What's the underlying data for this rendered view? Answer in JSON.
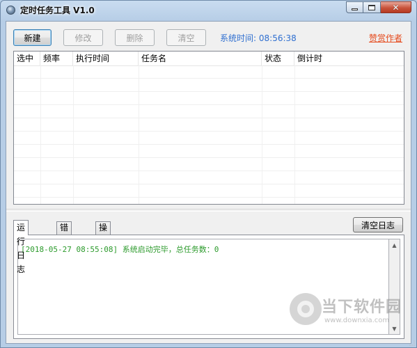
{
  "window": {
    "title": "定时任务工具 V1.0"
  },
  "toolbar": {
    "new_label": "新建",
    "edit_label": "修改",
    "delete_label": "删除",
    "clear_label": "清空",
    "systime_label": "系统时间:",
    "systime_value": "08:56:38",
    "sponsor_label": "赞赏作者"
  },
  "task_table": {
    "columns": [
      "选中",
      "频率",
      "执行时间",
      "任务名",
      "状态",
      "倒计时"
    ],
    "rows": []
  },
  "log_panel": {
    "tabs": [
      "运行日志",
      "错误日志",
      "操作日志"
    ],
    "active_tab": "运行日志",
    "clear_label": "清空日志",
    "lines": [
      "[2018-05-27 08:55:08] 系统启动完毕，总任务数：0"
    ]
  },
  "watermark": {
    "text": "当下软件园",
    "url": "www.downxia.com"
  },
  "colors": {
    "systime": "#2f6fd0",
    "sponsor": "#e5481a",
    "log_text": "#2b9a2b"
  },
  "icons": [
    "app-icon",
    "minimize-icon",
    "maximize-icon",
    "close-icon",
    "scroll-up-icon",
    "scroll-down-icon"
  ]
}
